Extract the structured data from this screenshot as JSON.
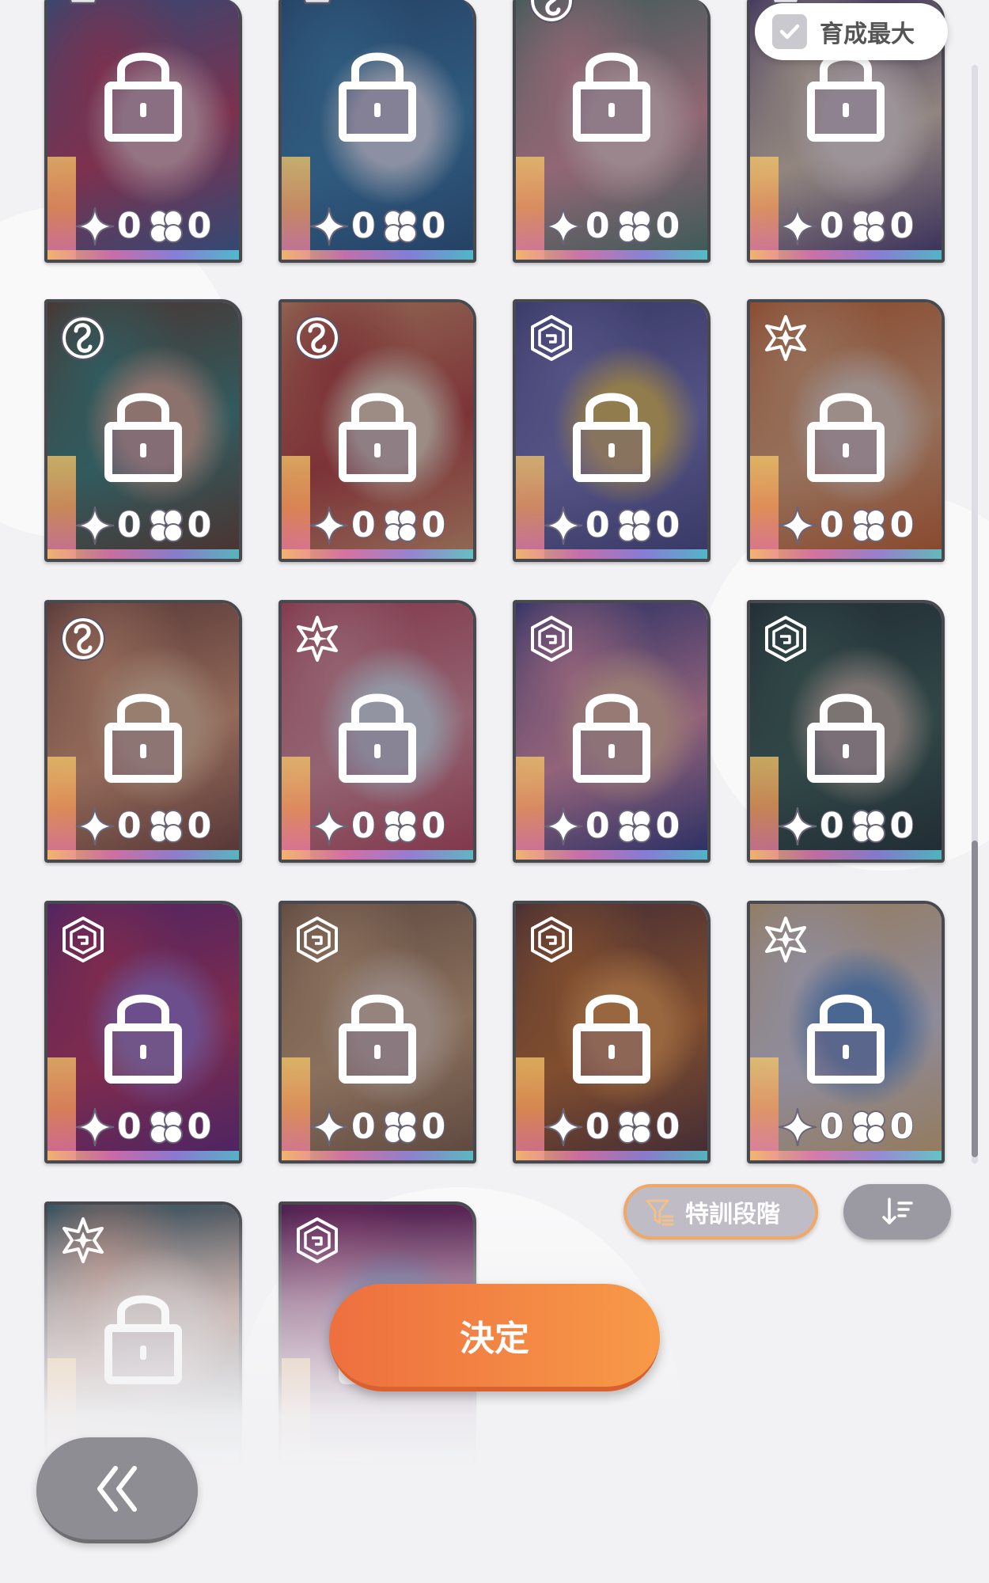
{
  "max_toggle": {
    "label": "育成最大",
    "checked": true
  },
  "cards": [
    {
      "attribute": "pure-icon",
      "star": "0",
      "clover": "0",
      "colors": [
        "#3b6fa8",
        "#c04466",
        "#e9b6c0"
      ]
    },
    {
      "attribute": "pure-icon",
      "star": "0",
      "clover": "0",
      "colors": [
        "#2a5e8a",
        "#3c8cb8",
        "#d9e8f4"
      ]
    },
    {
      "attribute": "cute-icon",
      "star": "0",
      "clover": "0",
      "colors": [
        "#4e8a74",
        "#e4a0a6",
        "#f4d6d0"
      ]
    },
    {
      "attribute": "pure-icon",
      "star": "0",
      "clover": "0",
      "colors": [
        "#4a3e78",
        "#e5d5b8",
        "#f6ece4"
      ]
    },
    {
      "attribute": "cute-icon",
      "star": "0",
      "clover": "0",
      "colors": [
        "#6d4630",
        "#3f8c80",
        "#d9b49a"
      ]
    },
    {
      "attribute": "cute-icon",
      "star": "0",
      "clover": "0",
      "colors": [
        "#e4a772",
        "#c0473d",
        "#f6e0c2"
      ]
    },
    {
      "attribute": "cool-icon",
      "star": "0",
      "clover": "0",
      "colors": [
        "#4a4f8c",
        "#7b7ec2",
        "#e3c463"
      ]
    },
    {
      "attribute": "happy-icon",
      "star": "0",
      "clover": "0",
      "colors": [
        "#d46a2a",
        "#ecb07a",
        "#f4e0c8"
      ]
    },
    {
      "attribute": "cute-icon",
      "star": "0",
      "clover": "0",
      "colors": [
        "#7a4a3a",
        "#e7a577",
        "#f0c89c"
      ]
    },
    {
      "attribute": "happy-icon",
      "star": "0",
      "clover": "0",
      "colors": [
        "#c64c5c",
        "#e89aa2",
        "#e7eef4"
      ]
    },
    {
      "attribute": "cool-icon",
      "star": "0",
      "clover": "0",
      "colors": [
        "#2e3e8a",
        "#e69ab0",
        "#f0c2a6"
      ]
    },
    {
      "attribute": "cool-icon",
      "star": "0",
      "clover": "0",
      "colors": [
        "#223a38",
        "#3f6a58",
        "#bfb7a2"
      ]
    },
    {
      "attribute": "cool-icon",
      "star": "0",
      "clover": "0",
      "colors": [
        "#6a2e8a",
        "#c33a64",
        "#a676d0"
      ]
    },
    {
      "attribute": "cool-icon",
      "star": "0",
      "clover": "0",
      "colors": [
        "#8a6a4a",
        "#d7b07e",
        "#e9d2b6"
      ]
    },
    {
      "attribute": "cool-icon",
      "star": "0",
      "clover": "0",
      "colors": [
        "#5a3a3a",
        "#c7752e",
        "#f0a04c"
      ]
    },
    {
      "attribute": "happy-icon",
      "star": "0",
      "clover": "0",
      "colors": [
        "#e8c27a",
        "#e0e0ea",
        "#6aa0d8"
      ]
    },
    {
      "attribute": "happy-icon",
      "star": "",
      "clover": "",
      "colors": [
        "#2e7a8a",
        "#f0b08e",
        "#f6dcc6"
      ]
    },
    {
      "attribute": "cool-icon",
      "star": "",
      "clover": "",
      "colors": [
        "#6a2a6a",
        "#a83a7a",
        "#4a5aa8"
      ]
    }
  ],
  "filter": {
    "label": "特訓段階"
  },
  "decide": {
    "label": "決定"
  },
  "colors": {
    "accent": "#f0a868",
    "decide_start": "#ee6f3f",
    "decide_end": "#f79a48",
    "back": "#8e8d93"
  }
}
